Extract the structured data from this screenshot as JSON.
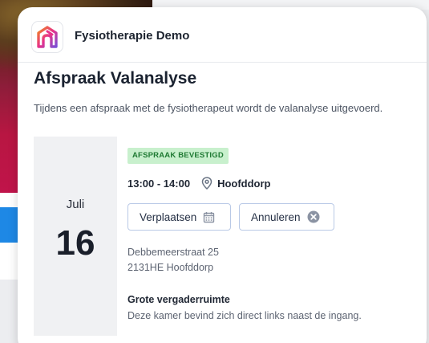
{
  "org": {
    "name": "Fysiotherapie Demo",
    "logo_icon": "fysio-logo-icon",
    "brand_colors": [
      "#e8328a",
      "#f08a1c",
      "#7a4fd6"
    ]
  },
  "appointment": {
    "title": "Afspraak Valanalyse",
    "description": "Tijdens een afspraak met de fysiotherapeut wordt de valanalyse uitgevoerd.",
    "status": "AFSPRAAK BEVESTIGD",
    "status_color": "#1f7a33",
    "month": "Juli",
    "day": "16",
    "time": "13:00 - 14:00",
    "location_icon": "map-pin-icon",
    "location": "Hoofddorp",
    "address_line1": "Debbemeerstraat 25",
    "address_line2": "2131HE Hoofddorp",
    "room_title": "Grote vergaderruimte",
    "room_description": "Deze kamer bevind zich direct links naast de ingang."
  },
  "actions": {
    "reschedule_label": "Verplaatsen",
    "reschedule_icon": "calendar-icon",
    "cancel_label": "Annuleren",
    "cancel_icon": "close-circle-icon"
  }
}
